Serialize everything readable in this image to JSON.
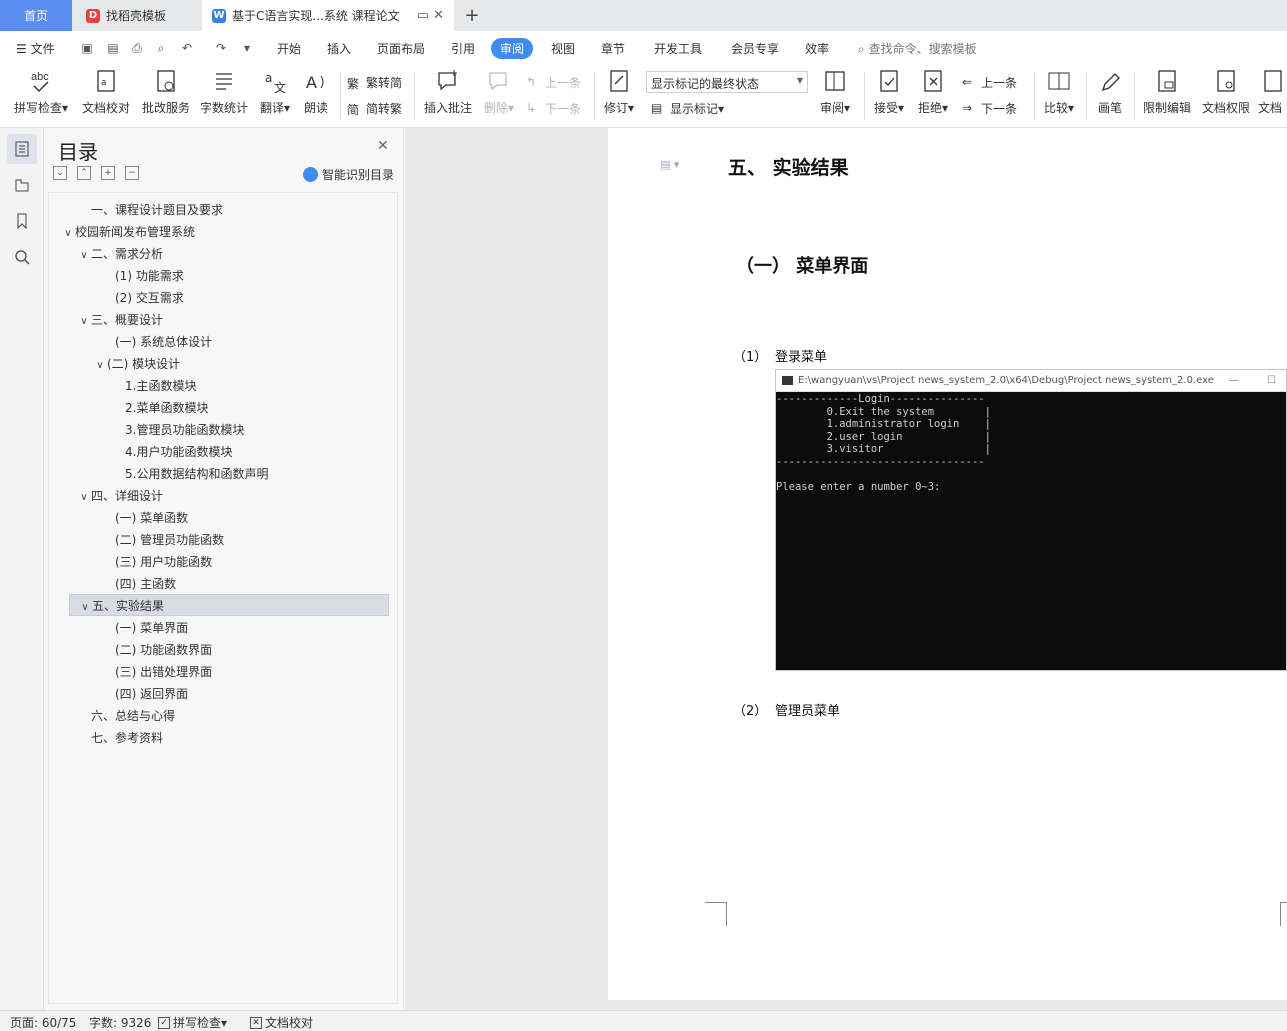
{
  "tabs": {
    "home": "首页",
    "daoke": "找稻壳模板",
    "doc": "基于C语言实现...系统 课程论文"
  },
  "menu": {
    "file": "文件",
    "items": [
      "开始",
      "插入",
      "页面布局",
      "引用",
      "审阅",
      "视图",
      "章节",
      "开发工具",
      "会员专享",
      "效率"
    ],
    "active": "审阅",
    "search_placeholder": "查找命令、搜索模板"
  },
  "ribbon": {
    "spellcheck": "拼写检查",
    "doc_proof": "文档校对",
    "review_service": "批改服务",
    "word_count": "字数统计",
    "translate": "翻译",
    "read_aloud": "朗读",
    "trad_to_simp": "繁转简",
    "simp_to_trad": "简转繁",
    "insert_comment": "插入批注",
    "delete": "删除",
    "prev_comment": "上一条",
    "next_comment": "下一条",
    "revise": "修订",
    "markup_state": "显示标记的最终状态",
    "show_markup": "显示标记",
    "review": "审阅",
    "accept": "接受",
    "reject": "拒绝",
    "prev_change": "上一条",
    "next_change": "下一条",
    "compare": "比较",
    "pen": "画笔",
    "restrict_edit": "限制编辑",
    "doc_rights": "文档权限",
    "doc_more": "文档"
  },
  "toc": {
    "title": "目录",
    "smart": "智能识别目录",
    "items": [
      {
        "text": "一、课程设计题目及要求"
      },
      {
        "text": "校园新闻发布管理系统"
      },
      {
        "text": "二、需求分析"
      },
      {
        "text": "(1) 功能需求"
      },
      {
        "text": "(2) 交互需求"
      },
      {
        "text": "三、概要设计"
      },
      {
        "text": "(一) 系统总体设计"
      },
      {
        "text": "(二) 模块设计"
      },
      {
        "text": "1.主函数模块"
      },
      {
        "text": "2.菜单函数模块"
      },
      {
        "text": "3.管理员功能函数模块"
      },
      {
        "text": "4.用户功能函数模块"
      },
      {
        "text": "5.公用数据结构和函数声明"
      },
      {
        "text": "四、详细设计"
      },
      {
        "text": "(一) 菜单函数"
      },
      {
        "text": "(二) 管理员功能函数"
      },
      {
        "text": "(三) 用户功能函数"
      },
      {
        "text": "(四) 主函数"
      },
      {
        "text": "五、实验结果"
      },
      {
        "text": "(一) 菜单界面"
      },
      {
        "text": "(二) 功能函数界面"
      },
      {
        "text": "(三) 出错处理界面"
      },
      {
        "text": "(四) 返回界面"
      },
      {
        "text": "六、总结与心得"
      },
      {
        "text": "七、参考资料"
      }
    ]
  },
  "doc": {
    "h1": "五、 实验结果",
    "h2": "（一） 菜单界面",
    "p1_num": "（1）",
    "p1_text": "登录菜单",
    "p2_num": "（2）",
    "p2_text": "管理员菜单",
    "console_title": "E:\\wangyuan\\vs\\Project news_system_2.0\\x64\\Debug\\Project news_system_2.0.exe",
    "console_lines": [
      "-------------Login---------------",
      "        0.Exit the system        |",
      "        1.administrator login    |",
      "        2.user login             |",
      "        3.visitor                |",
      "---------------------------------",
      "",
      "Please enter a number 0~3:"
    ]
  },
  "status": {
    "page": "页面: 60/75",
    "words": "字数: 9326",
    "spellcheck": "拼写检查",
    "doc_proof": "文档校对"
  }
}
